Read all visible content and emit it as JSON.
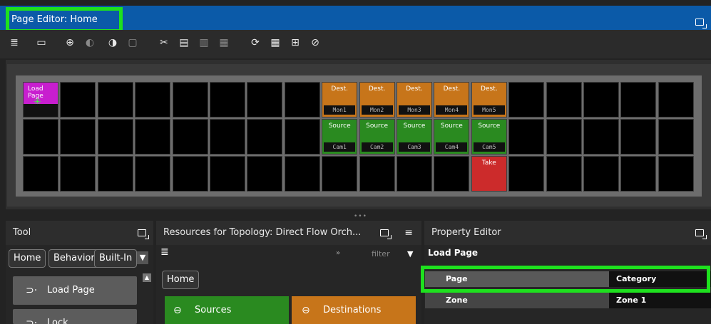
{
  "window": {
    "title": "Page Editor: Home"
  },
  "toolbar": {
    "icons": [
      "list-icon",
      "card-icon",
      "add-icon",
      "duplicate-icon",
      "rotate-icon",
      "delete-icon",
      "cut-icon",
      "copy-icon",
      "paste-icon",
      "paste-special-icon",
      "refresh-icon",
      "layout-grid-icon",
      "layout-tile-icon",
      "trash-icon"
    ]
  },
  "grid": {
    "load_page": {
      "label": "Load Page"
    },
    "dest": [
      {
        "label": "Dest.",
        "sub": "Mon1"
      },
      {
        "label": "Dest.",
        "sub": "Mon2"
      },
      {
        "label": "Dest.",
        "sub": "Mon3"
      },
      {
        "label": "Dest.",
        "sub": "Mon4"
      },
      {
        "label": "Dest.",
        "sub": "Mon5"
      }
    ],
    "source": [
      {
        "label": "Source",
        "sub": "Cam1"
      },
      {
        "label": "Source",
        "sub": "Cam2"
      },
      {
        "label": "Source",
        "sub": "Cam3"
      },
      {
        "label": "Source",
        "sub": "Cam4"
      },
      {
        "label": "Source",
        "sub": "Cam5"
      }
    ],
    "take": {
      "label": "Take"
    }
  },
  "tool_panel": {
    "title": "Tool",
    "breadcrumbs": [
      "Home",
      "Behavior",
      "Built-In"
    ],
    "items": [
      {
        "label": "Load Page",
        "icon": "plug-icon"
      },
      {
        "label": "Lock",
        "icon": "plug-icon"
      }
    ]
  },
  "resources_panel": {
    "title": "Resources for Topology: Direct Flow Orch...",
    "filter_placeholder": "filter",
    "breadcrumb": "Home",
    "sources_label": "Sources",
    "destinations_label": "Destinations",
    "colors": {
      "sources": "#2a8a20",
      "destinations": "#c7751a"
    }
  },
  "property_panel": {
    "title": "Property Editor",
    "section": "Load Page",
    "rows": [
      {
        "key": "Page",
        "value": "Category"
      },
      {
        "key": "Zone",
        "value": "Zone 1"
      }
    ]
  }
}
